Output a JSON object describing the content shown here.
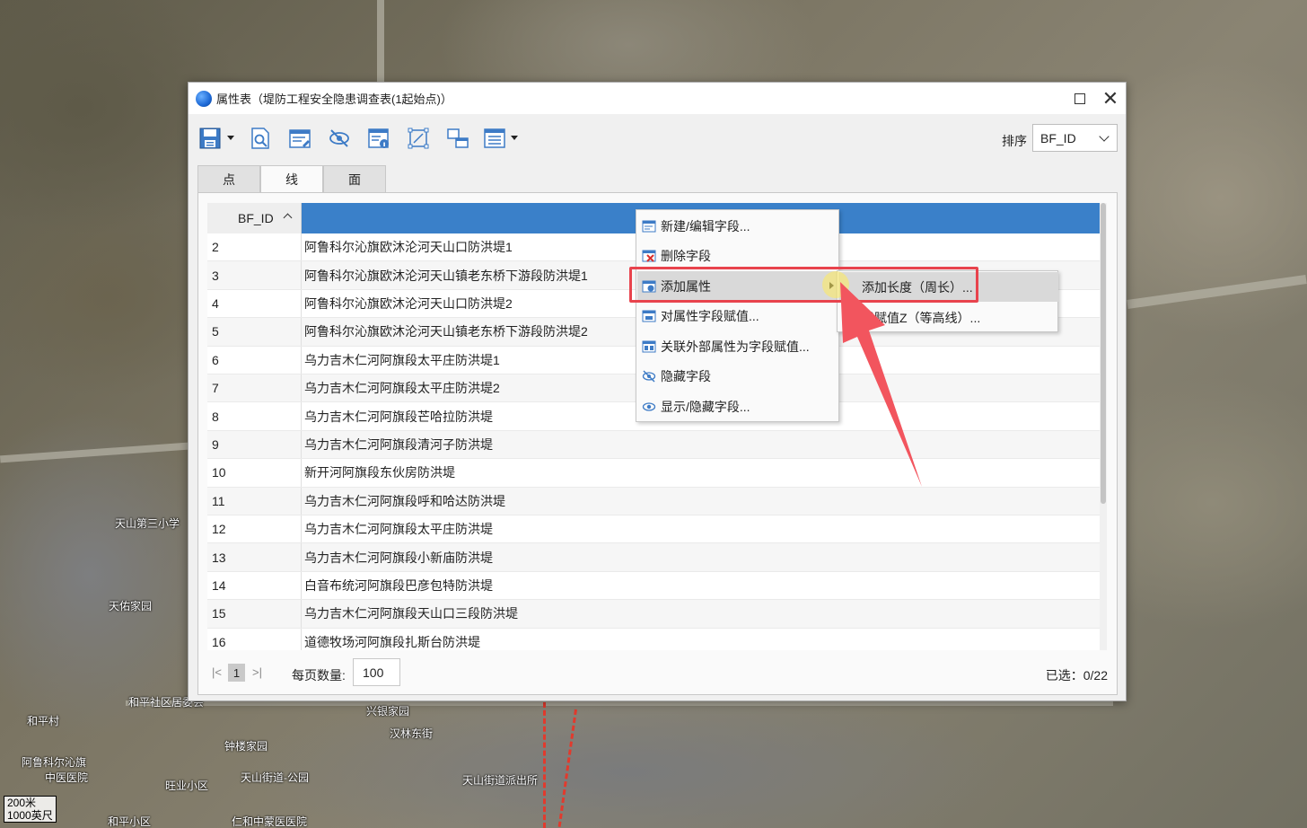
{
  "map": {
    "labels": [
      "天山第三小学",
      "天佑家园",
      "和平社区居委会",
      "和平村",
      "阿鲁科尔沁旗",
      "中医医院",
      "钟楼家园",
      "汉林东街",
      "天山街道-公园",
      "天山街道派出所",
      "旺业小区",
      "兴银家园",
      "仁和中蒙医医院",
      "和平小区"
    ],
    "scale": [
      "200米",
      "1000英尺"
    ]
  },
  "window": {
    "title": "属性表（堤防工程安全隐患调查表(1起始点)）",
    "sort_label": "排序",
    "sort_value": "BF_ID"
  },
  "toolbar": {
    "icons": [
      "save-icon",
      "query-icon",
      "edit-icon",
      "hide-icon",
      "table-info-icon",
      "select-geometry-icon",
      "link-icon",
      "list-view-icon"
    ]
  },
  "tabs": [
    {
      "label": "点"
    },
    {
      "label": "线"
    },
    {
      "label": "面"
    }
  ],
  "table": {
    "columns": [
      "BF_ID",
      ""
    ],
    "rows": [
      {
        "id": "2",
        "name": "阿鲁科尔沁旗欧沐沦河天山口防洪堤1"
      },
      {
        "id": "3",
        "name": "阿鲁科尔沁旗欧沐沦河天山镇老东桥下游段防洪堤1"
      },
      {
        "id": "4",
        "name": "阿鲁科尔沁旗欧沐沦河天山口防洪堤2"
      },
      {
        "id": "5",
        "name": "阿鲁科尔沁旗欧沐沦河天山镇老东桥下游段防洪堤2"
      },
      {
        "id": "6",
        "name": "乌力吉木仁河阿旗段太平庄防洪堤1"
      },
      {
        "id": "7",
        "name": "乌力吉木仁河阿旗段太平庄防洪堤2"
      },
      {
        "id": "8",
        "name": "乌力吉木仁河阿旗段芒哈拉防洪堤"
      },
      {
        "id": "9",
        "name": "乌力吉木仁河阿旗段清河子防洪堤"
      },
      {
        "id": "10",
        "name": "新开河阿旗段东伙房防洪堤"
      },
      {
        "id": "11",
        "name": "乌力吉木仁河阿旗段呼和哈达防洪堤"
      },
      {
        "id": "12",
        "name": "乌力吉木仁河阿旗段太平庄防洪堤"
      },
      {
        "id": "13",
        "name": "乌力吉木仁河阿旗段小新庙防洪堤"
      },
      {
        "id": "14",
        "name": "白音布统河阿旗段巴彦包特防洪堤"
      },
      {
        "id": "15",
        "name": "乌力吉木仁河阿旗段天山口三段防洪堤"
      },
      {
        "id": "16",
        "name": "道德牧场河阿旗段扎斯台防洪堤"
      }
    ]
  },
  "pager": {
    "first": "|<",
    "page": "1",
    "last": ">|",
    "per_page_label": "每页数量:",
    "per_page_value": "100",
    "selected": "已选：0/22"
  },
  "context_menu": {
    "items": [
      {
        "label": "新建/编辑字段...",
        "icon": "new-field-icon"
      },
      {
        "label": "删除字段",
        "icon": "delete-field-icon"
      },
      {
        "label": "添加属性",
        "icon": "add-attribute-icon",
        "has_submenu": true
      },
      {
        "label": "对属性字段赋值...",
        "icon": "assign-value-icon"
      },
      {
        "label": "关联外部属性为字段赋值...",
        "icon": "link-external-icon"
      },
      {
        "label": "隐藏字段",
        "icon": "hide-field-icon"
      },
      {
        "label": "显示/隐藏字段...",
        "icon": "show-hide-field-icon"
      }
    ],
    "submenu": [
      {
        "label": "添加长度（周长）..."
      },
      {
        "label": "线赋值Z（等高线）..."
      }
    ]
  },
  "colors": {
    "header_selected": "#3a80c9",
    "highlight_box": "#e8434d",
    "arrow": "#f2555e"
  }
}
